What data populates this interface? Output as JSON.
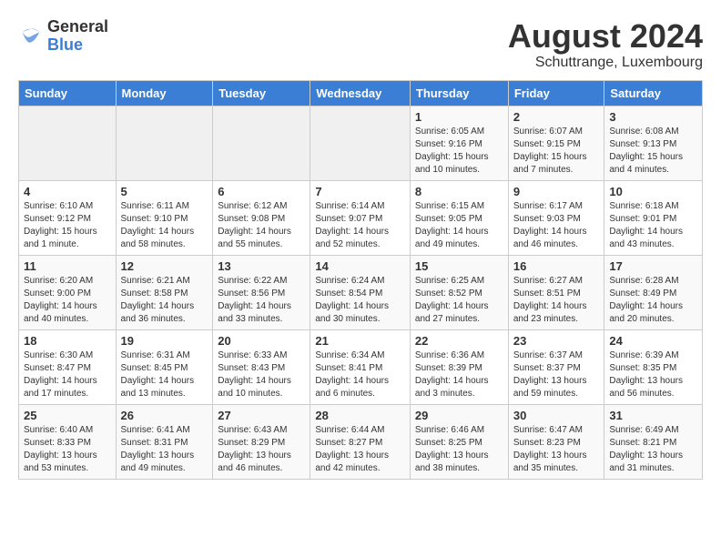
{
  "logo": {
    "general": "General",
    "blue": "Blue"
  },
  "title": "August 2024",
  "subtitle": "Schuttrange, Luxembourg",
  "days_header": [
    "Sunday",
    "Monday",
    "Tuesday",
    "Wednesday",
    "Thursday",
    "Friday",
    "Saturday"
  ],
  "weeks": [
    [
      {
        "day": "",
        "info": ""
      },
      {
        "day": "",
        "info": ""
      },
      {
        "day": "",
        "info": ""
      },
      {
        "day": "",
        "info": ""
      },
      {
        "day": "1",
        "info": "Sunrise: 6:05 AM\nSunset: 9:16 PM\nDaylight: 15 hours\nand 10 minutes."
      },
      {
        "day": "2",
        "info": "Sunrise: 6:07 AM\nSunset: 9:15 PM\nDaylight: 15 hours\nand 7 minutes."
      },
      {
        "day": "3",
        "info": "Sunrise: 6:08 AM\nSunset: 9:13 PM\nDaylight: 15 hours\nand 4 minutes."
      }
    ],
    [
      {
        "day": "4",
        "info": "Sunrise: 6:10 AM\nSunset: 9:12 PM\nDaylight: 15 hours\nand 1 minute."
      },
      {
        "day": "5",
        "info": "Sunrise: 6:11 AM\nSunset: 9:10 PM\nDaylight: 14 hours\nand 58 minutes."
      },
      {
        "day": "6",
        "info": "Sunrise: 6:12 AM\nSunset: 9:08 PM\nDaylight: 14 hours\nand 55 minutes."
      },
      {
        "day": "7",
        "info": "Sunrise: 6:14 AM\nSunset: 9:07 PM\nDaylight: 14 hours\nand 52 minutes."
      },
      {
        "day": "8",
        "info": "Sunrise: 6:15 AM\nSunset: 9:05 PM\nDaylight: 14 hours\nand 49 minutes."
      },
      {
        "day": "9",
        "info": "Sunrise: 6:17 AM\nSunset: 9:03 PM\nDaylight: 14 hours\nand 46 minutes."
      },
      {
        "day": "10",
        "info": "Sunrise: 6:18 AM\nSunset: 9:01 PM\nDaylight: 14 hours\nand 43 minutes."
      }
    ],
    [
      {
        "day": "11",
        "info": "Sunrise: 6:20 AM\nSunset: 9:00 PM\nDaylight: 14 hours\nand 40 minutes."
      },
      {
        "day": "12",
        "info": "Sunrise: 6:21 AM\nSunset: 8:58 PM\nDaylight: 14 hours\nand 36 minutes."
      },
      {
        "day": "13",
        "info": "Sunrise: 6:22 AM\nSunset: 8:56 PM\nDaylight: 14 hours\nand 33 minutes."
      },
      {
        "day": "14",
        "info": "Sunrise: 6:24 AM\nSunset: 8:54 PM\nDaylight: 14 hours\nand 30 minutes."
      },
      {
        "day": "15",
        "info": "Sunrise: 6:25 AM\nSunset: 8:52 PM\nDaylight: 14 hours\nand 27 minutes."
      },
      {
        "day": "16",
        "info": "Sunrise: 6:27 AM\nSunset: 8:51 PM\nDaylight: 14 hours\nand 23 minutes."
      },
      {
        "day": "17",
        "info": "Sunrise: 6:28 AM\nSunset: 8:49 PM\nDaylight: 14 hours\nand 20 minutes."
      }
    ],
    [
      {
        "day": "18",
        "info": "Sunrise: 6:30 AM\nSunset: 8:47 PM\nDaylight: 14 hours\nand 17 minutes."
      },
      {
        "day": "19",
        "info": "Sunrise: 6:31 AM\nSunset: 8:45 PM\nDaylight: 14 hours\nand 13 minutes."
      },
      {
        "day": "20",
        "info": "Sunrise: 6:33 AM\nSunset: 8:43 PM\nDaylight: 14 hours\nand 10 minutes."
      },
      {
        "day": "21",
        "info": "Sunrise: 6:34 AM\nSunset: 8:41 PM\nDaylight: 14 hours\nand 6 minutes."
      },
      {
        "day": "22",
        "info": "Sunrise: 6:36 AM\nSunset: 8:39 PM\nDaylight: 14 hours\nand 3 minutes."
      },
      {
        "day": "23",
        "info": "Sunrise: 6:37 AM\nSunset: 8:37 PM\nDaylight: 13 hours\nand 59 minutes."
      },
      {
        "day": "24",
        "info": "Sunrise: 6:39 AM\nSunset: 8:35 PM\nDaylight: 13 hours\nand 56 minutes."
      }
    ],
    [
      {
        "day": "25",
        "info": "Sunrise: 6:40 AM\nSunset: 8:33 PM\nDaylight: 13 hours\nand 53 minutes."
      },
      {
        "day": "26",
        "info": "Sunrise: 6:41 AM\nSunset: 8:31 PM\nDaylight: 13 hours\nand 49 minutes."
      },
      {
        "day": "27",
        "info": "Sunrise: 6:43 AM\nSunset: 8:29 PM\nDaylight: 13 hours\nand 46 minutes."
      },
      {
        "day": "28",
        "info": "Sunrise: 6:44 AM\nSunset: 8:27 PM\nDaylight: 13 hours\nand 42 minutes."
      },
      {
        "day": "29",
        "info": "Sunrise: 6:46 AM\nSunset: 8:25 PM\nDaylight: 13 hours\nand 38 minutes."
      },
      {
        "day": "30",
        "info": "Sunrise: 6:47 AM\nSunset: 8:23 PM\nDaylight: 13 hours\nand 35 minutes."
      },
      {
        "day": "31",
        "info": "Sunrise: 6:49 AM\nSunset: 8:21 PM\nDaylight: 13 hours\nand 31 minutes."
      }
    ]
  ]
}
